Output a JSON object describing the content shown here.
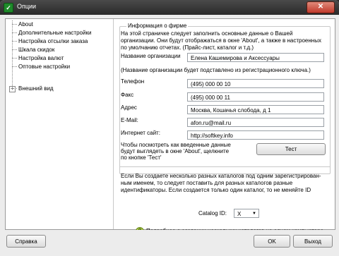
{
  "window": {
    "title": "Опции",
    "icon": "app-logo-icon",
    "close_label": "✕"
  },
  "tree": {
    "items": [
      {
        "label": "About"
      },
      {
        "label": "Дополнительные настройки"
      },
      {
        "label": "Настройка отсылки заказа"
      },
      {
        "label": "Шкала скидок"
      },
      {
        "label": "Настройка валют"
      },
      {
        "label": "Оптовые настройки"
      },
      {
        "label": "Внешний вид",
        "expander": "+"
      }
    ]
  },
  "form": {
    "group_title": "Информация о фирме",
    "intro": [
      "На этой страничке следует заполнить основные данные о Вашей",
      "организации. Они будут отображаться в окне 'About', а также в настроенных",
      "по умолчанию отчетах. (Прайс-лист, каталог и т.д.)"
    ],
    "org_name_label": "Название организации",
    "org_name_value": "Елена Кашемирова и Аксессуары",
    "org_name_note": "(Название организации будет подставлено из регистрационного ключа.)",
    "phone_label": "Телефон",
    "phone_value": "(495) 000 00 10",
    "fax_label": "Факс",
    "fax_value": "(495) 000 00 11",
    "address_label": "Адрес",
    "address_value": "Москва, Кошачья слобода, д 1",
    "email_label": "E-Mail:",
    "email_value": "afon.ru@mail.ru",
    "site_label": "Интернет сайт:",
    "site_value": "http://softkey.info",
    "test_hint": [
      "Чтобы посмотреть как введенные данные",
      "будут выглядеть в окне 'About', щелкните",
      "по кнопке 'Тест'"
    ],
    "test_button": "Тест"
  },
  "catalog": {
    "text": [
      "Если Вы создаете несколько разных каталогов под одним зарегистрирован-",
      "ным именем, то следует поставить для разных каталогов разные",
      "идентификаторы. Если создается только один каталог, то не меняйте ID"
    ],
    "id_label": "Catalog ID:",
    "id_value": "X",
    "help_text": "Подробнее о создании нескольких каталогов на одном компьютере",
    "help_icon": "question-mark-icon"
  },
  "footer": {
    "help_button": "Справка",
    "ok_button": "OK",
    "exit_button": "Выход"
  }
}
